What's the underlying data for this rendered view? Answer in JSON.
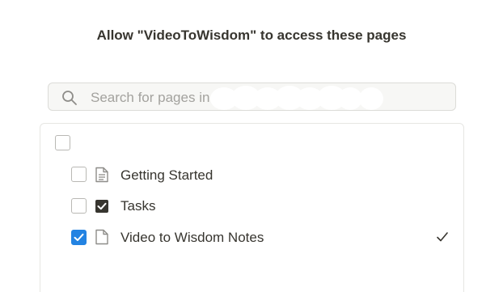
{
  "dialog": {
    "title": "Allow \"VideoToWisdom\" to access these pages"
  },
  "search": {
    "placeholder": "Search for pages in",
    "icon": "search-icon"
  },
  "pages": {
    "select_all": {
      "checked": false
    },
    "items": [
      {
        "label": "Getting Started",
        "icon": "document-icon",
        "checked": false,
        "selected": false
      },
      {
        "label": "Tasks",
        "icon": "checkbox-icon",
        "checked": false,
        "selected": false
      },
      {
        "label": "Video to Wisdom Notes",
        "icon": "document-icon",
        "checked": true,
        "selected": true
      }
    ]
  },
  "colors": {
    "accent": "#2383e2",
    "text": "#37352f",
    "placeholder": "#a3a29e"
  }
}
